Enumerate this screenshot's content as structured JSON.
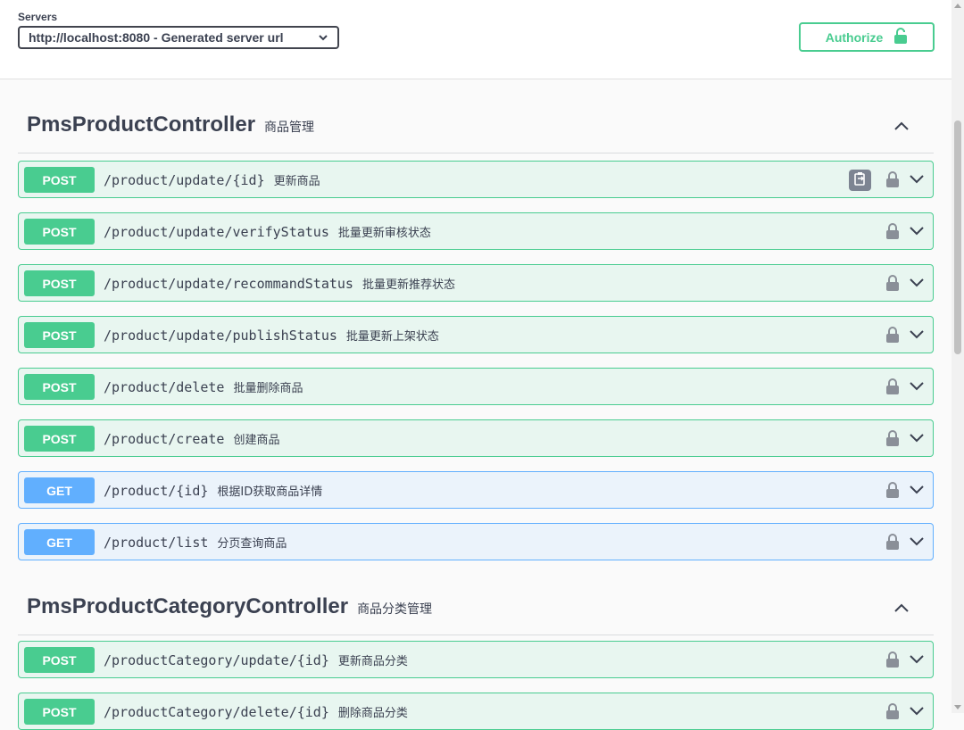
{
  "servers": {
    "label": "Servers",
    "selected": "http://localhost:8080 - Generated server url"
  },
  "authorize": {
    "label": "Authorize"
  },
  "sections": [
    {
      "name": "PmsProductController",
      "description": "商品管理",
      "operations": [
        {
          "method": "POST",
          "path": "/product/update/{id}",
          "summary": "更新商品"
        },
        {
          "method": "POST",
          "path": "/product/update/verifyStatus",
          "summary": "批量更新审核状态"
        },
        {
          "method": "POST",
          "path": "/product/update/recommandStatus",
          "summary": "批量更新推荐状态"
        },
        {
          "method": "POST",
          "path": "/product/update/publishStatus",
          "summary": "批量更新上架状态"
        },
        {
          "method": "POST",
          "path": "/product/delete",
          "summary": "批量删除商品"
        },
        {
          "method": "POST",
          "path": "/product/create",
          "summary": "创建商品"
        },
        {
          "method": "GET",
          "path": "/product/{id}",
          "summary": "根据ID获取商品详情"
        },
        {
          "method": "GET",
          "path": "/product/list",
          "summary": "分页查询商品"
        }
      ]
    },
    {
      "name": "PmsProductCategoryController",
      "description": "商品分类管理",
      "operations": [
        {
          "method": "POST",
          "path": "/productCategory/update/{id}",
          "summary": "更新商品分类"
        },
        {
          "method": "POST",
          "path": "/productCategory/delete/{id}",
          "summary": "删除商品分类"
        }
      ]
    }
  ],
  "icons": {
    "lock": "lock-icon",
    "chevron": "chevron-down-icon",
    "collapse": "chevron-up-icon",
    "copy": "clipboard-icon"
  },
  "colors": {
    "post": "#49cc90",
    "post_bg": "#e8f6f0",
    "get": "#61affe",
    "get_bg": "#ebf3fb",
    "authorize": "#49cc90"
  }
}
